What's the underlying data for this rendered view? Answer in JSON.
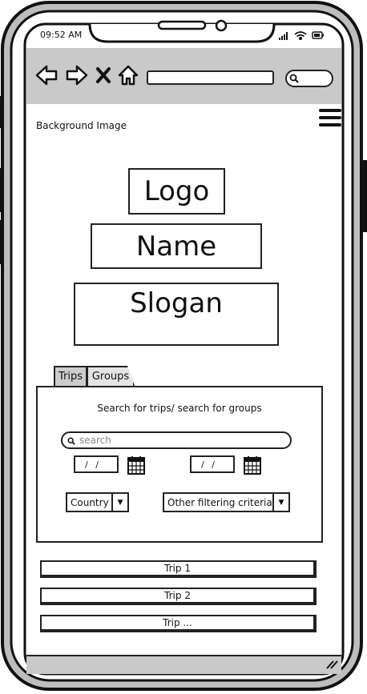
{
  "status_bar": {
    "time": "09:52 AM"
  },
  "browser": {
    "nav_icons": [
      "back-arrow-icon",
      "forward-arrow-icon",
      "close-icon",
      "home-icon"
    ],
    "url_value": "",
    "search_icon": "search-icon"
  },
  "page": {
    "background_label": "Background Image",
    "menu_icon": "hamburger-icon",
    "logo": "Logo",
    "name": "Name",
    "slogan": "Slogan"
  },
  "tabs": [
    {
      "label": "Trips",
      "selected": true
    },
    {
      "label": "Groups",
      "selected": false
    }
  ],
  "search_panel": {
    "title": "Search for trips/ search for groups",
    "search_placeholder": "search",
    "date_from": "/ /",
    "date_to": "/ /",
    "country_select": "Country",
    "other_select": "Other filtering criteria"
  },
  "results": [
    "Trip 1",
    "Trip 2",
    "Trip ..."
  ]
}
